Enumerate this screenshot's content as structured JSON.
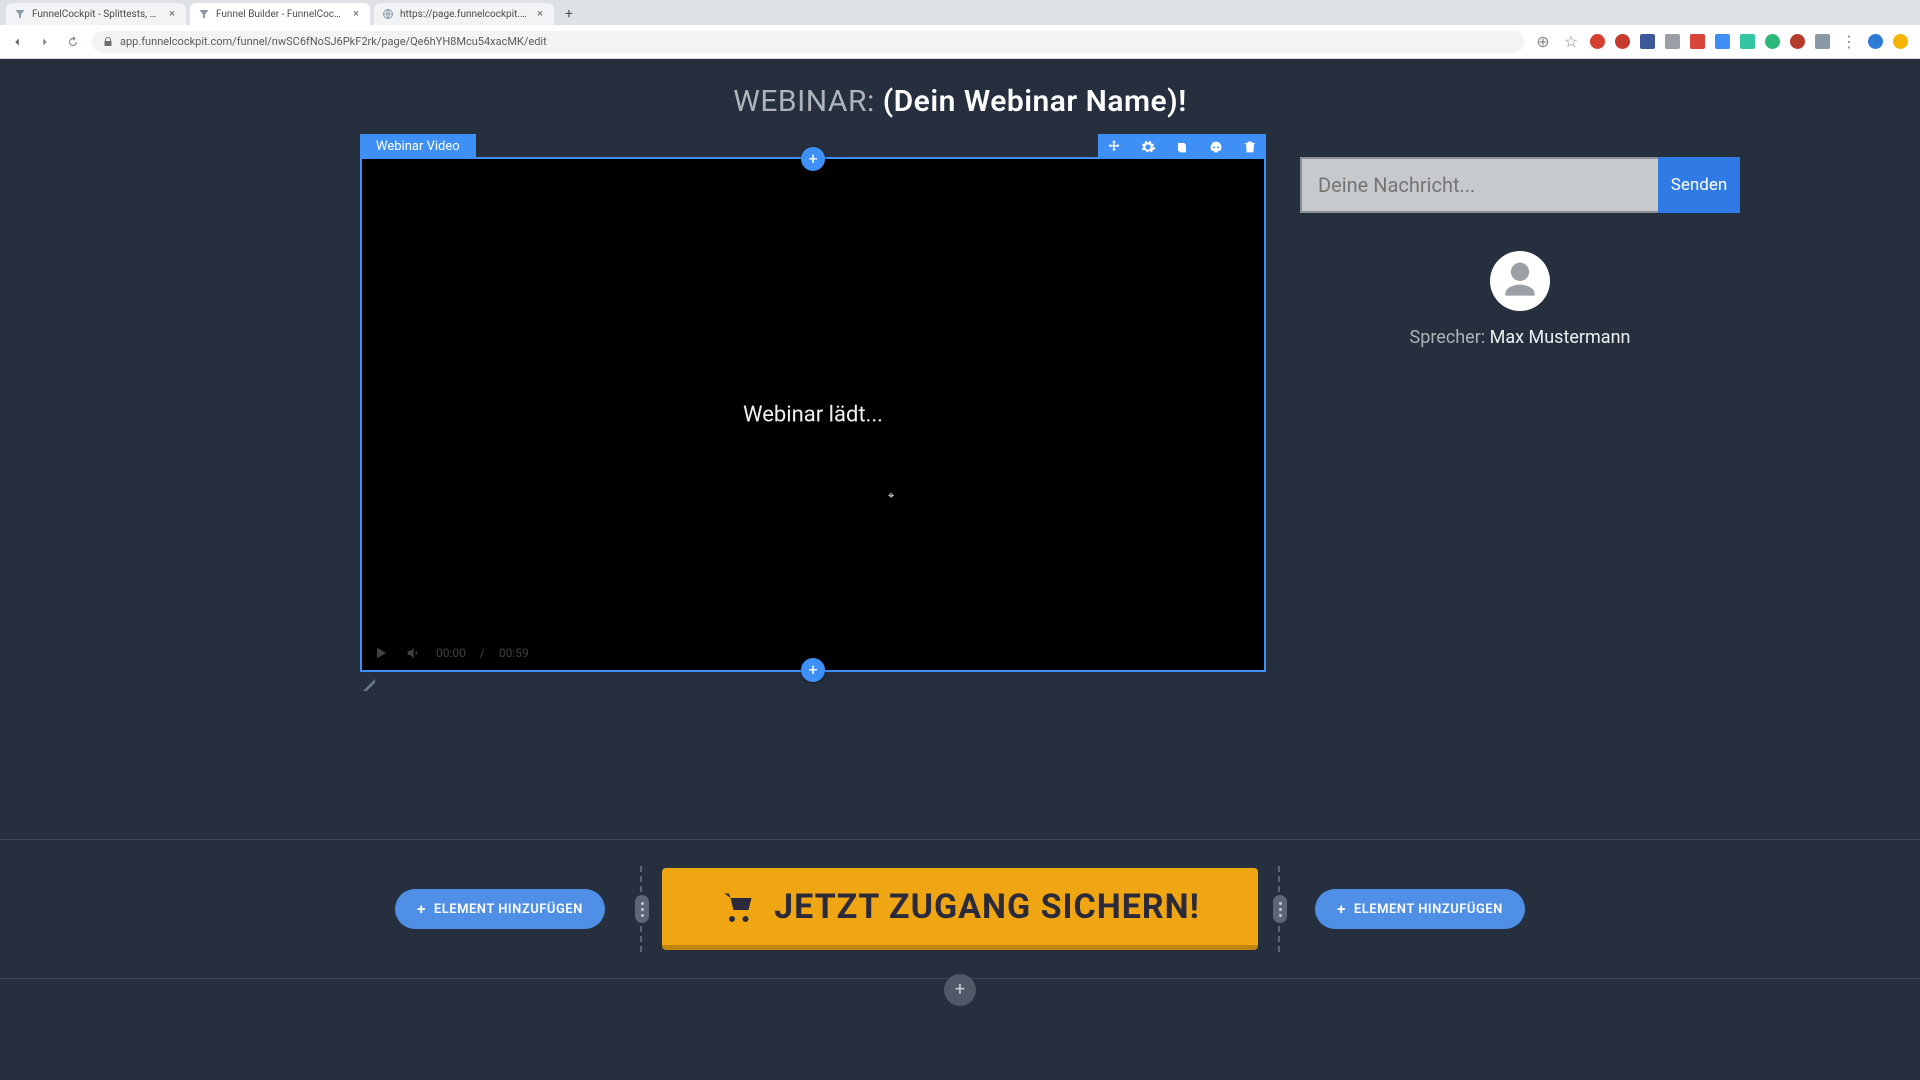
{
  "browser": {
    "tabs": [
      {
        "title": "FunnelCockpit - Splittests, Ma"
      },
      {
        "title": "Funnel Builder - FunnelCockpit"
      },
      {
        "title": "https://page.funnelcockpit.co"
      }
    ],
    "url": "app.funnelcockpit.com/funnel/nwSC6fNoSJ6PkF2rk/page/Qe6hYH8Mcu54xacMK/edit"
  },
  "headline": {
    "prefix": "WEBINAR: ",
    "name": "(Dein Webinar Name)!"
  },
  "editor": {
    "element_label": "Webinar Video",
    "loading_text": "Webinar lädt...",
    "time_current": "00:00",
    "time_sep": "/",
    "time_total": "00:59"
  },
  "chat": {
    "placeholder": "Deine Nachricht...",
    "send_label": "Senden"
  },
  "speaker": {
    "label": "Sprecher: ",
    "name": "Max Mustermann"
  },
  "cta": {
    "add_element_label": "ELEMENT HINZUFÜGEN",
    "main_button": "JETZT ZUGANG SICHERN!"
  }
}
